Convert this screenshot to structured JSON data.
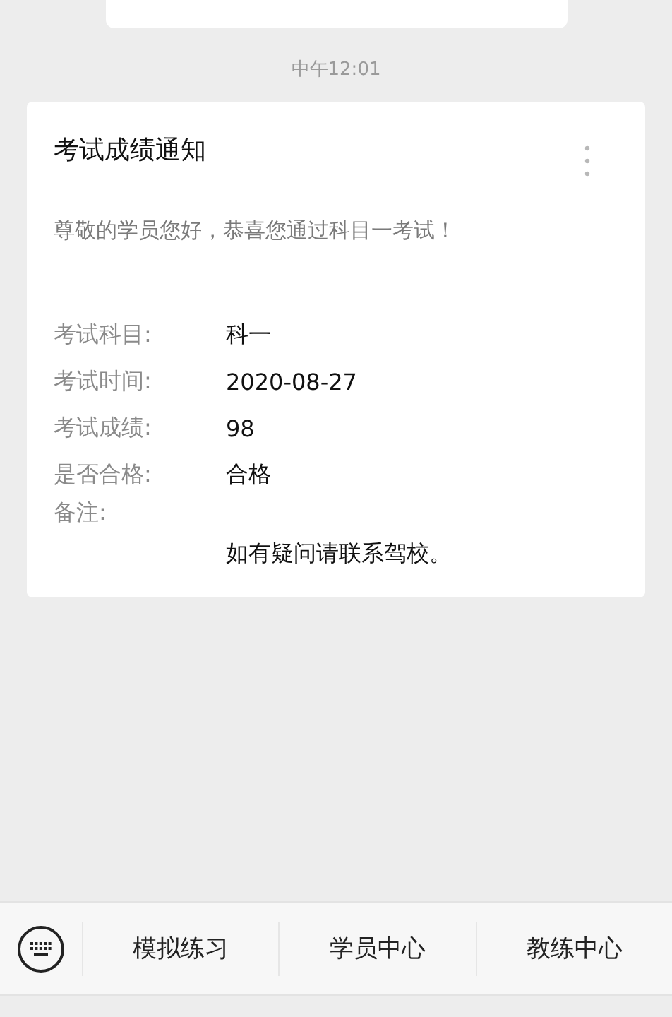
{
  "timestamp": "中午12:01",
  "card": {
    "title": "考试成绩通知",
    "greeting": "尊敬的学员您好，恭喜您通过科目一考试！",
    "fields": [
      {
        "label": "考试科目:",
        "value": "科一"
      },
      {
        "label": "考试时间:",
        "value": "2020-08-27"
      },
      {
        "label": "考试成绩:",
        "value": "98"
      },
      {
        "label": "是否合格:",
        "value": "合格"
      },
      {
        "label": "备注:",
        "value": "如有疑问请联系驾校。"
      }
    ]
  },
  "menu": [
    "模拟练习",
    "学员中心",
    "教练中心"
  ]
}
